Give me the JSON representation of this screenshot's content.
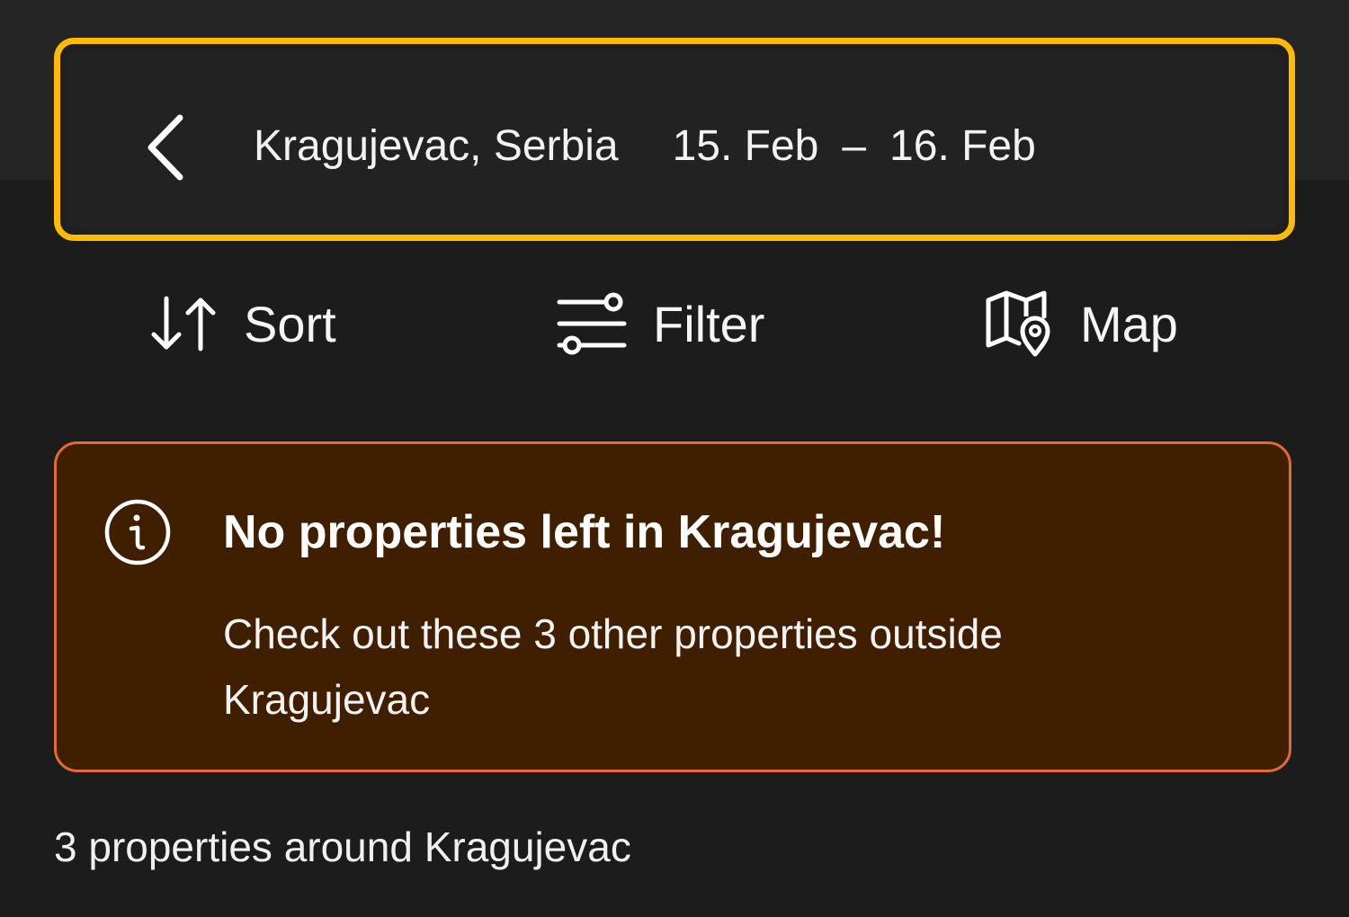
{
  "search": {
    "location": "Kragujevac, Serbia",
    "check_in": "15. Feb",
    "separator": "–",
    "check_out": "16. Feb",
    "accent_color": "#febb02"
  },
  "toolbar": {
    "sort_label": "Sort",
    "sort_icon": "sort-arrows-icon",
    "filter_label": "Filter",
    "filter_icon": "sliders-icon",
    "map_label": "Map",
    "map_icon": "map-pin-icon"
  },
  "alert": {
    "icon": "info-icon",
    "title": "No properties left in Kragujevac!",
    "body": "Check out these 3 other properties outside Kragujevac",
    "background_color": "#401f00",
    "border_color": "#e36b2c"
  },
  "results": {
    "count_text": "3 properties around Kragujevac"
  }
}
